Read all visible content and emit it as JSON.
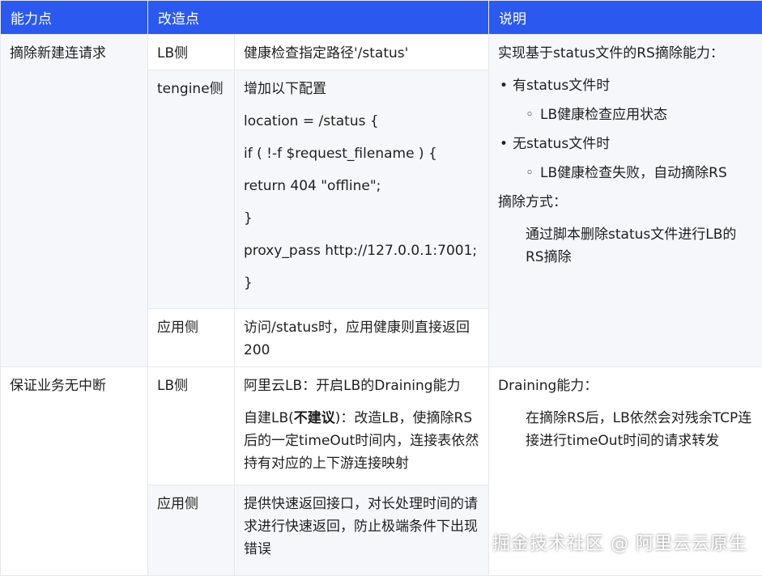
{
  "header": {
    "col1": "能力点",
    "col2": "改造点",
    "col3": "说明"
  },
  "rows": [
    {
      "capability": "摘除新建连请求",
      "sub": [
        {
          "side": "LB侧",
          "detail": [
            "健康检查指定路径'/status'"
          ]
        },
        {
          "side": "tengine侧",
          "detail": [
            "增加以下配置",
            "location = /status {",
            "if ( !-f $request_filename ) {",
            "return 404 \"offline\";",
            "}",
            "proxy_pass http://127.0.0.1:7001;",
            "}"
          ]
        },
        {
          "side": "应用侧",
          "detail": [
            "访问/status时，应用健康则直接返回200"
          ]
        }
      ],
      "notes": {
        "intro": "实现基于status文件的RS摘除能力：",
        "b1": "有status文件时",
        "b1a": "LB健康检查应用状态",
        "b2": "无status文件时",
        "b2a": "LB健康检查失败，自动摘除RS",
        "method": "摘除方式：",
        "method_text": "通过脚本删除status文件进行LB的RS摘除"
      }
    },
    {
      "capability": "保证业务无中断",
      "sub": [
        {
          "side": "LB侧",
          "detail1": "阿里云LB：开启LB的Draining能力",
          "detail2_pre": "自建LB(",
          "detail2_bold": "不建议",
          "detail2_post": ")：改造LB，使摘除RS后的一定timeOut时间内，连接表依然持有对应的上下游连接映射"
        },
        {
          "side": "应用侧",
          "detail": [
            "提供快速返回接口，对长处理时间的请求进行快速返回，防止极端条件下出现错误"
          ]
        }
      ],
      "notes": {
        "title": "Draining能力：",
        "text": "在摘除RS后，LB依然会对残余TCP连接进行timeOut时间的请求转发"
      }
    }
  ],
  "watermark": "掘金技术社区 @ 阿里云云原生",
  "colors": {
    "header_bg": "#2b59f0",
    "cell_gray": "#f6f7fa",
    "border": "#e4e7ee"
  }
}
